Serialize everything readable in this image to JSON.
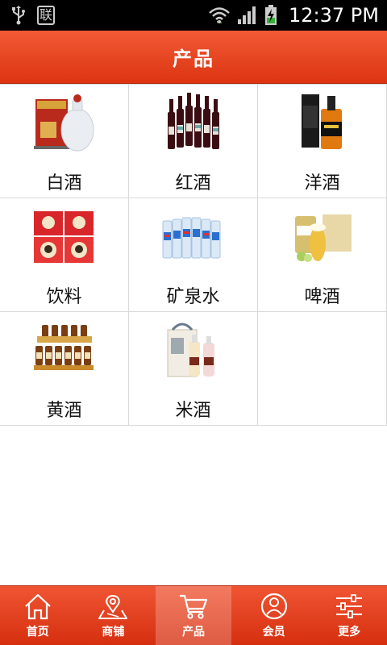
{
  "status_bar": {
    "carrier_glyph": "联",
    "time": "12:37 PM",
    "icons": [
      "usb-icon",
      "carrier-icon",
      "wifi-icon",
      "signal-icon",
      "battery-charging-icon"
    ]
  },
  "header": {
    "title": "产品"
  },
  "products": [
    {
      "label": "白酒",
      "icon": "baijiu-image"
    },
    {
      "label": "红酒",
      "icon": "red-wine-image"
    },
    {
      "label": "洋酒",
      "icon": "whisky-image"
    },
    {
      "label": "饮料",
      "icon": "beverage-image"
    },
    {
      "label": "矿泉水",
      "icon": "mineral-water-image"
    },
    {
      "label": "啤酒",
      "icon": "beer-image"
    },
    {
      "label": "黄酒",
      "icon": "yellow-wine-image"
    },
    {
      "label": "米酒",
      "icon": "rice-wine-image"
    }
  ],
  "bottom_nav": [
    {
      "label": "首页",
      "icon": "home-icon",
      "active": false
    },
    {
      "label": "商铺",
      "icon": "map-pin-icon",
      "active": false
    },
    {
      "label": "产品",
      "icon": "cart-icon",
      "active": true
    },
    {
      "label": "会员",
      "icon": "user-icon",
      "active": false
    },
    {
      "label": "更多",
      "icon": "sliders-icon",
      "active": false
    }
  ],
  "colors": {
    "accent": "#e5401c",
    "status_bg": "#000000"
  }
}
